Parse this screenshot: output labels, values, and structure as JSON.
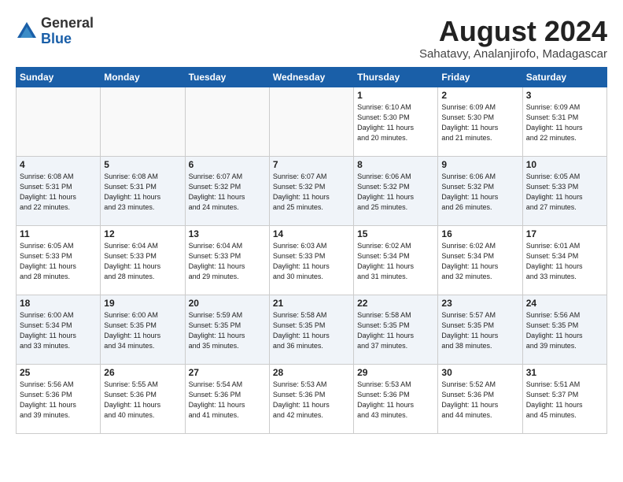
{
  "logo": {
    "general": "General",
    "blue": "Blue"
  },
  "title": "August 2024",
  "location": "Sahatavy, Analanjirofo, Madagascar",
  "headers": [
    "Sunday",
    "Monday",
    "Tuesday",
    "Wednesday",
    "Thursday",
    "Friday",
    "Saturday"
  ],
  "weeks": [
    [
      {
        "day": "",
        "info": ""
      },
      {
        "day": "",
        "info": ""
      },
      {
        "day": "",
        "info": ""
      },
      {
        "day": "",
        "info": ""
      },
      {
        "day": "1",
        "info": "Sunrise: 6:10 AM\nSunset: 5:30 PM\nDaylight: 11 hours\nand 20 minutes."
      },
      {
        "day": "2",
        "info": "Sunrise: 6:09 AM\nSunset: 5:30 PM\nDaylight: 11 hours\nand 21 minutes."
      },
      {
        "day": "3",
        "info": "Sunrise: 6:09 AM\nSunset: 5:31 PM\nDaylight: 11 hours\nand 22 minutes."
      }
    ],
    [
      {
        "day": "4",
        "info": "Sunrise: 6:08 AM\nSunset: 5:31 PM\nDaylight: 11 hours\nand 22 minutes."
      },
      {
        "day": "5",
        "info": "Sunrise: 6:08 AM\nSunset: 5:31 PM\nDaylight: 11 hours\nand 23 minutes."
      },
      {
        "day": "6",
        "info": "Sunrise: 6:07 AM\nSunset: 5:32 PM\nDaylight: 11 hours\nand 24 minutes."
      },
      {
        "day": "7",
        "info": "Sunrise: 6:07 AM\nSunset: 5:32 PM\nDaylight: 11 hours\nand 25 minutes."
      },
      {
        "day": "8",
        "info": "Sunrise: 6:06 AM\nSunset: 5:32 PM\nDaylight: 11 hours\nand 25 minutes."
      },
      {
        "day": "9",
        "info": "Sunrise: 6:06 AM\nSunset: 5:32 PM\nDaylight: 11 hours\nand 26 minutes."
      },
      {
        "day": "10",
        "info": "Sunrise: 6:05 AM\nSunset: 5:33 PM\nDaylight: 11 hours\nand 27 minutes."
      }
    ],
    [
      {
        "day": "11",
        "info": "Sunrise: 6:05 AM\nSunset: 5:33 PM\nDaylight: 11 hours\nand 28 minutes."
      },
      {
        "day": "12",
        "info": "Sunrise: 6:04 AM\nSunset: 5:33 PM\nDaylight: 11 hours\nand 28 minutes."
      },
      {
        "day": "13",
        "info": "Sunrise: 6:04 AM\nSunset: 5:33 PM\nDaylight: 11 hours\nand 29 minutes."
      },
      {
        "day": "14",
        "info": "Sunrise: 6:03 AM\nSunset: 5:33 PM\nDaylight: 11 hours\nand 30 minutes."
      },
      {
        "day": "15",
        "info": "Sunrise: 6:02 AM\nSunset: 5:34 PM\nDaylight: 11 hours\nand 31 minutes."
      },
      {
        "day": "16",
        "info": "Sunrise: 6:02 AM\nSunset: 5:34 PM\nDaylight: 11 hours\nand 32 minutes."
      },
      {
        "day": "17",
        "info": "Sunrise: 6:01 AM\nSunset: 5:34 PM\nDaylight: 11 hours\nand 33 minutes."
      }
    ],
    [
      {
        "day": "18",
        "info": "Sunrise: 6:00 AM\nSunset: 5:34 PM\nDaylight: 11 hours\nand 33 minutes."
      },
      {
        "day": "19",
        "info": "Sunrise: 6:00 AM\nSunset: 5:35 PM\nDaylight: 11 hours\nand 34 minutes."
      },
      {
        "day": "20",
        "info": "Sunrise: 5:59 AM\nSunset: 5:35 PM\nDaylight: 11 hours\nand 35 minutes."
      },
      {
        "day": "21",
        "info": "Sunrise: 5:58 AM\nSunset: 5:35 PM\nDaylight: 11 hours\nand 36 minutes."
      },
      {
        "day": "22",
        "info": "Sunrise: 5:58 AM\nSunset: 5:35 PM\nDaylight: 11 hours\nand 37 minutes."
      },
      {
        "day": "23",
        "info": "Sunrise: 5:57 AM\nSunset: 5:35 PM\nDaylight: 11 hours\nand 38 minutes."
      },
      {
        "day": "24",
        "info": "Sunrise: 5:56 AM\nSunset: 5:35 PM\nDaylight: 11 hours\nand 39 minutes."
      }
    ],
    [
      {
        "day": "25",
        "info": "Sunrise: 5:56 AM\nSunset: 5:36 PM\nDaylight: 11 hours\nand 39 minutes."
      },
      {
        "day": "26",
        "info": "Sunrise: 5:55 AM\nSunset: 5:36 PM\nDaylight: 11 hours\nand 40 minutes."
      },
      {
        "day": "27",
        "info": "Sunrise: 5:54 AM\nSunset: 5:36 PM\nDaylight: 11 hours\nand 41 minutes."
      },
      {
        "day": "28",
        "info": "Sunrise: 5:53 AM\nSunset: 5:36 PM\nDaylight: 11 hours\nand 42 minutes."
      },
      {
        "day": "29",
        "info": "Sunrise: 5:53 AM\nSunset: 5:36 PM\nDaylight: 11 hours\nand 43 minutes."
      },
      {
        "day": "30",
        "info": "Sunrise: 5:52 AM\nSunset: 5:36 PM\nDaylight: 11 hours\nand 44 minutes."
      },
      {
        "day": "31",
        "info": "Sunrise: 5:51 AM\nSunset: 5:37 PM\nDaylight: 11 hours\nand 45 minutes."
      }
    ]
  ]
}
